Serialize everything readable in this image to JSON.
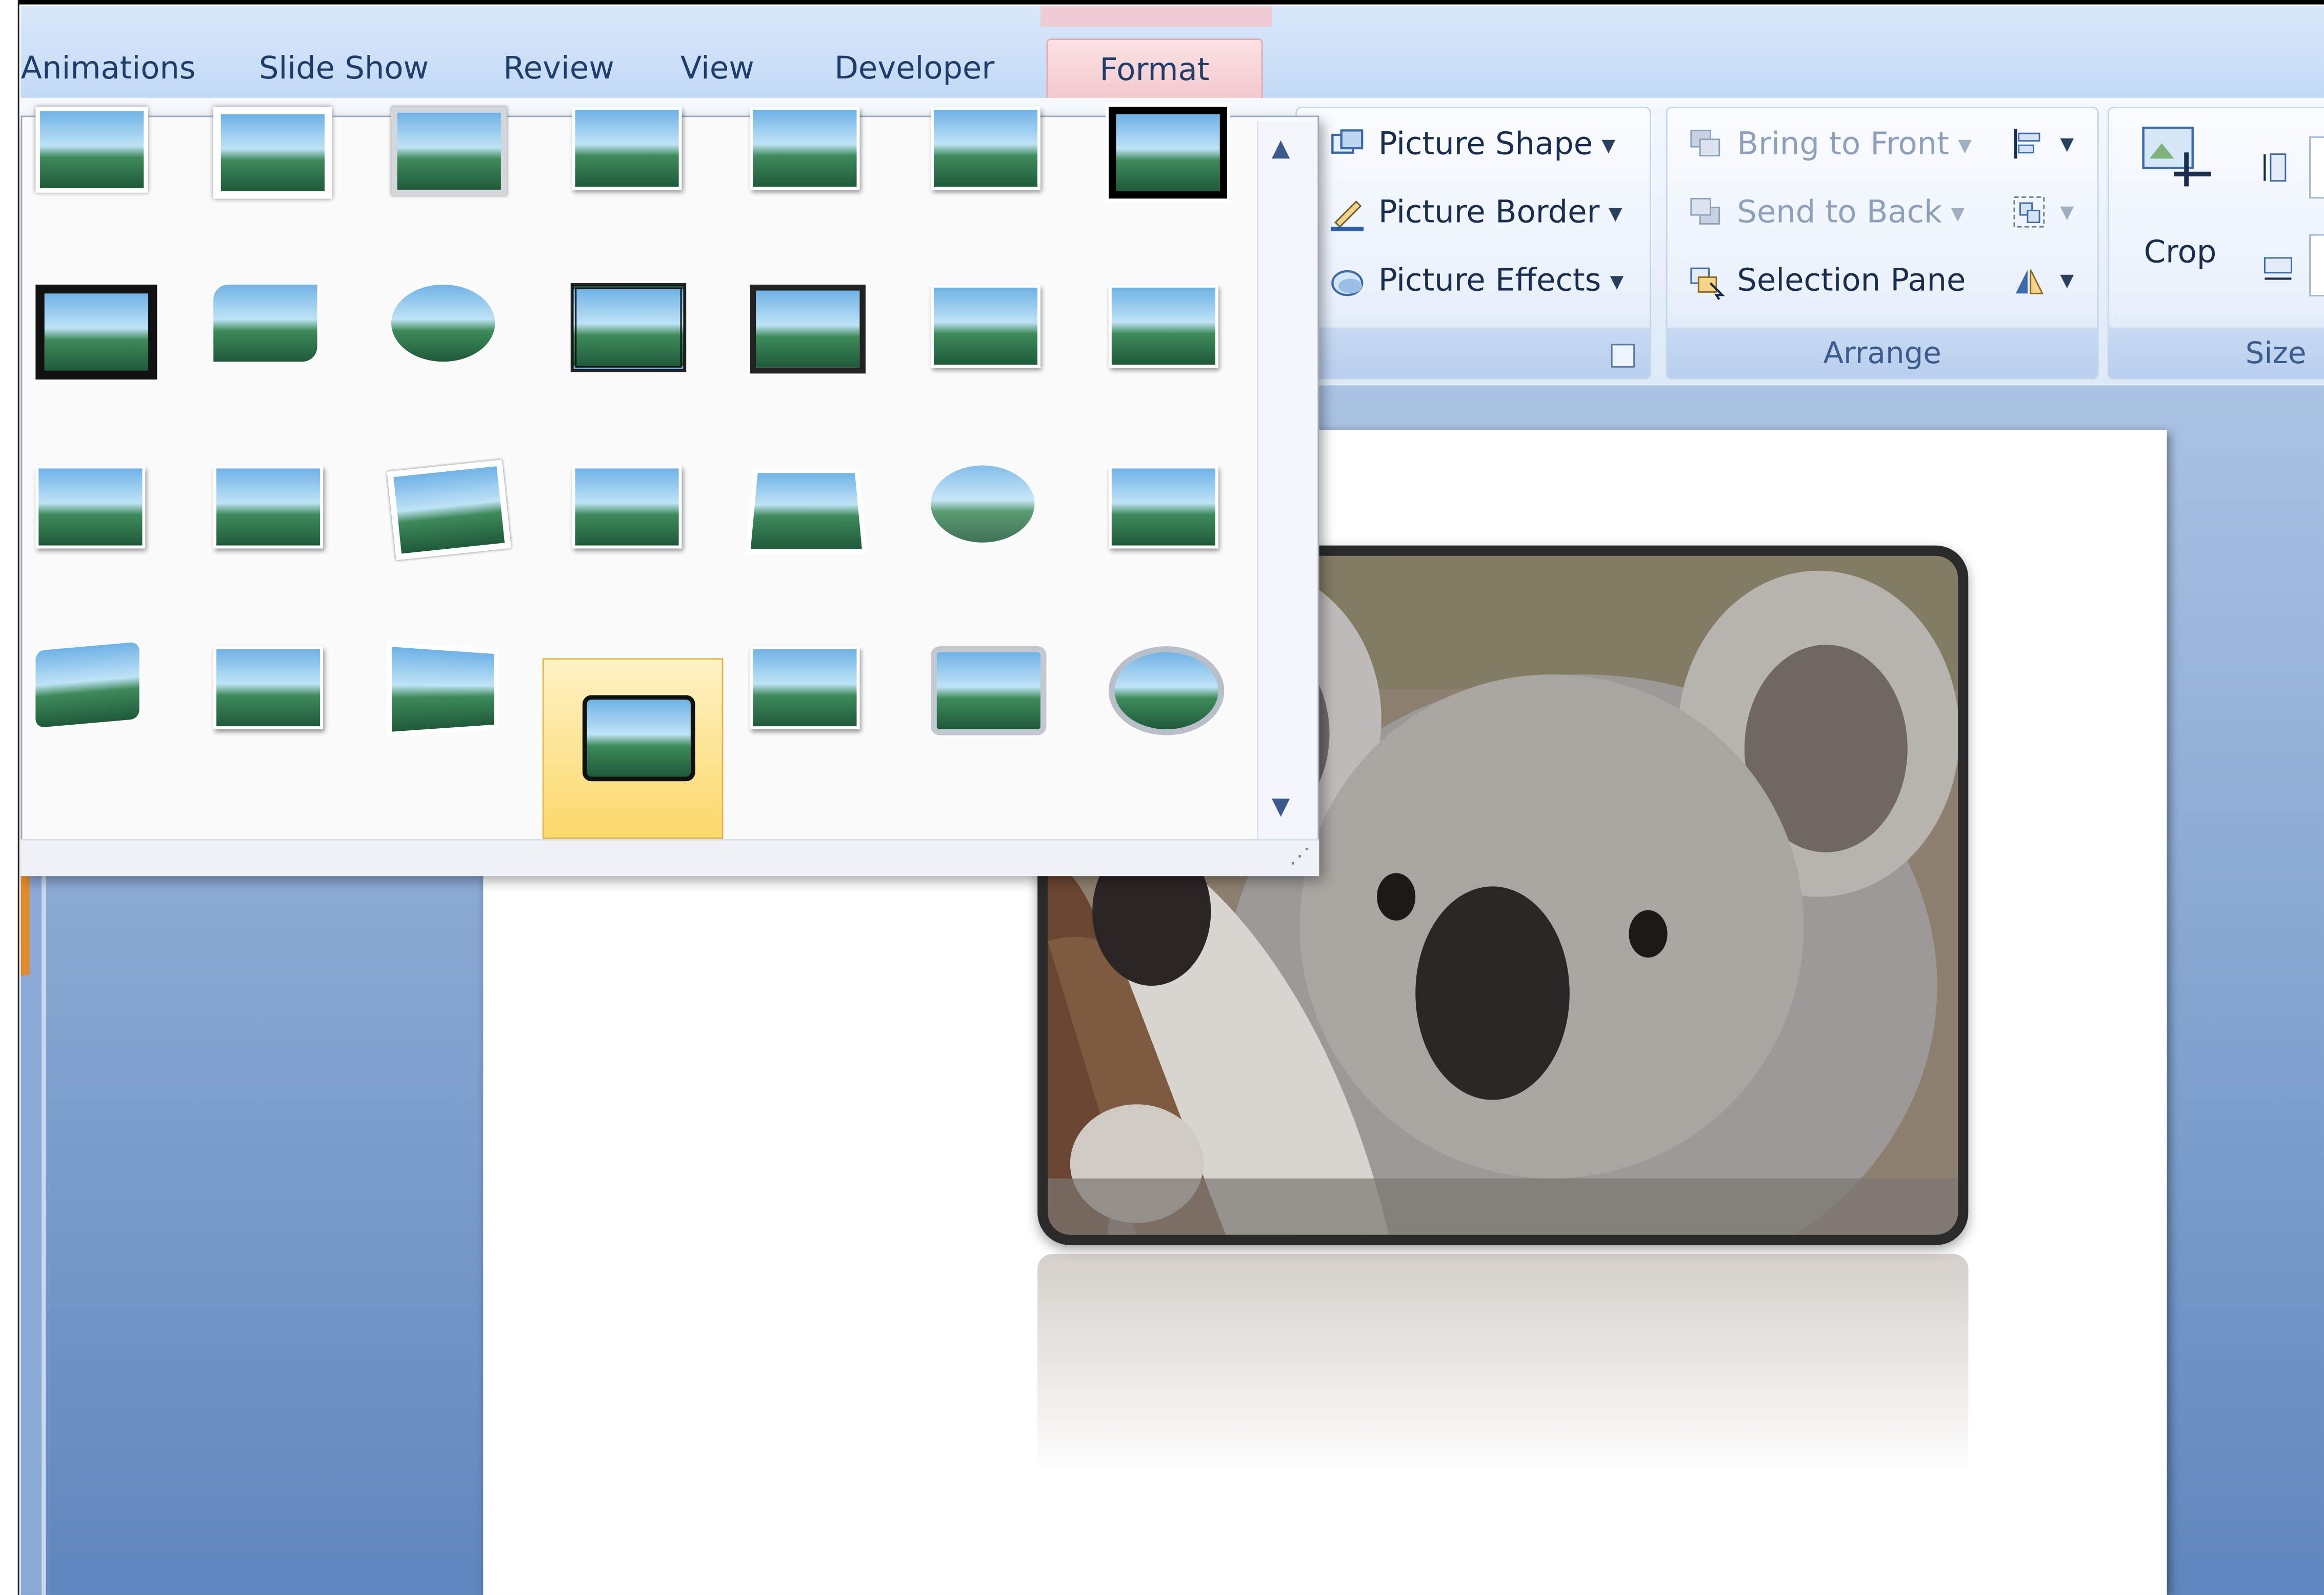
{
  "tabs": [
    {
      "label": "Animations",
      "active": false
    },
    {
      "label": "Slide Show",
      "active": false
    },
    {
      "label": "Review",
      "active": false
    },
    {
      "label": "View",
      "active": false
    },
    {
      "label": "Developer",
      "active": false
    },
    {
      "label": "Format",
      "active": true
    }
  ],
  "picture_styles_group": {
    "buttons": [
      {
        "label": "Picture Shape",
        "icon": "picture-shape-icon"
      },
      {
        "label": "Picture Border",
        "icon": "picture-border-icon"
      },
      {
        "label": "Picture Effects",
        "icon": "picture-effects-icon"
      }
    ]
  },
  "arrange_group": {
    "label": "Arrange",
    "buttons": [
      {
        "label": "Bring to Front",
        "icon": "bring-to-front-icon",
        "enabled": false
      },
      {
        "label": "Send to Back",
        "icon": "send-to-back-icon",
        "enabled": false
      },
      {
        "label": "Selection Pane",
        "icon": "selection-pane-icon",
        "enabled": true
      }
    ]
  },
  "size_group": {
    "label": "Size",
    "crop_label": "Crop"
  },
  "gallery": {
    "rows": 4,
    "columns": 7,
    "selected_index": 24,
    "styles": [
      "simple-frame-white",
      "beveled-matte-white",
      "metal-frame",
      "soft-edge-rectangle",
      "reflected-rounded-rectangle",
      "drop-shadow-rectangle",
      "thick-matte-black",
      "simple-frame-black",
      "rounded-diagonal-corner",
      "reflected-oval",
      "double-frame-black",
      "compound-frame-black",
      "soft-edge-glow",
      "moderate-frame-white",
      "snip-diagonal-corner",
      "center-shadow-rectangle",
      "rotated-white",
      "perspective-shadow",
      "relaxed-perspective-white",
      "soft-edge-oval",
      "bevel-rectangle",
      "bevel-perspective",
      "reflected-bevel-white",
      "bevel-perspective-left",
      "metal-rounded-rectangle",
      "reflected-perspective-right",
      "metal-frame-rounded",
      "metal-oval"
    ]
  },
  "colors": {
    "tab_bar": "#c2d9f5",
    "format_tab": "#f4c9cd",
    "selected_style": "#fbd86a",
    "workspace": "#7d9fcc"
  }
}
